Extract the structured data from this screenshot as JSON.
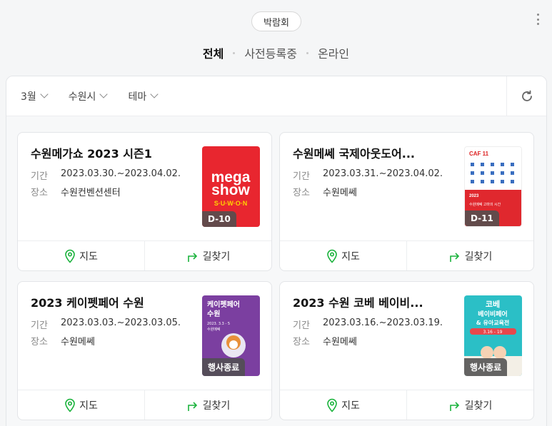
{
  "header": {
    "category_pill": "박람회"
  },
  "tabs": [
    {
      "label": "전체",
      "active": true
    },
    {
      "label": "사전등록중",
      "active": false
    },
    {
      "label": "온라인",
      "active": false
    }
  ],
  "filters": {
    "month": "3월",
    "city": "수원시",
    "theme": "테마"
  },
  "labels": {
    "period": "기간",
    "venue": "장소",
    "map": "지도",
    "directions": "길찾기"
  },
  "events": [
    {
      "title": "수원메가쇼 2023 시즌1",
      "period": "2023.03.30.~2023.04.02.",
      "venue": "수원컨벤션센터",
      "badge": "D-10",
      "poster": {
        "lines": [
          "mega",
          "show",
          "S·U·W·O·N"
        ],
        "bg": "#e8262f"
      }
    },
    {
      "title": "수원메쎄 국제아웃도어...",
      "period": "2023.03.31.~2023.04.02.",
      "venue": "수원메쎄",
      "badge": "D-11",
      "poster": {
        "lines": [
          "CAF 11",
          "2023",
          "수원메쎄 고마의 시간"
        ],
        "bg": "#ffffff"
      }
    },
    {
      "title": "2023 케이펫페어 수원",
      "period": "2023.03.03.~2023.03.05.",
      "venue": "수원메쎄",
      "badge": "행사종료",
      "poster": {
        "lines": [
          "케이펫페어",
          "수원",
          "2023. 3.3 - 5",
          "수원메쎄"
        ],
        "bg": "#7b3fa0"
      }
    },
    {
      "title": "2023 수원 코베 베이비...",
      "period": "2023.03.16.~2023.03.19.",
      "venue": "수원메쎄",
      "badge": "행사종료",
      "poster": {
        "lines": [
          "코베",
          "베이비페어",
          "& 유아교육전",
          "3.16 - 19"
        ],
        "bg": "#2bbfc6"
      }
    }
  ],
  "colors": {
    "accent_green": "#19b23b"
  },
  "icons": {
    "map": "map-pin-icon",
    "directions": "turn-arrow-icon",
    "refresh": "refresh-icon",
    "more": "more-vertical-icon"
  }
}
